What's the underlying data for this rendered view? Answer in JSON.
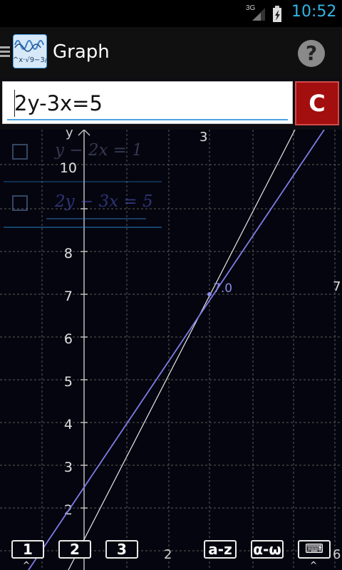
{
  "status_bar": {
    "network": "3G",
    "time": "10:52"
  },
  "action_bar": {
    "title": "Graph",
    "app_icon_label": "2^x·√9−3/2",
    "help_label": "?"
  },
  "input": {
    "value": "2y-3x=5",
    "clear_label": "C"
  },
  "equations": [
    {
      "text": "y − 2x = 1",
      "checked": false,
      "selected": false
    },
    {
      "text": "2y − 3x = 5",
      "checked": false,
      "selected": true
    }
  ],
  "graph": {
    "colors": {
      "background": "#05050f",
      "grid": "#6d6d6d",
      "axis": "#bdbdbd",
      "line1": "#e8e8e8",
      "line2": "#7d7de6",
      "intersection_label": "#8a8ae8"
    },
    "y_axis_label": "y",
    "y_ticks": [
      "2",
      "3",
      "4",
      "5",
      "6",
      "7",
      "8",
      "10"
    ],
    "x_ticks_bottom": [
      "2",
      "6"
    ],
    "top_label": "3",
    "right_label": "7",
    "intersection_label": "7.0"
  },
  "keyboard": {
    "keys": [
      {
        "label": "1"
      },
      {
        "label": "2"
      },
      {
        "label": "3"
      },
      {
        "label": "a-z"
      },
      {
        "label": "α-ω"
      },
      {
        "label": "⌨"
      }
    ]
  }
}
